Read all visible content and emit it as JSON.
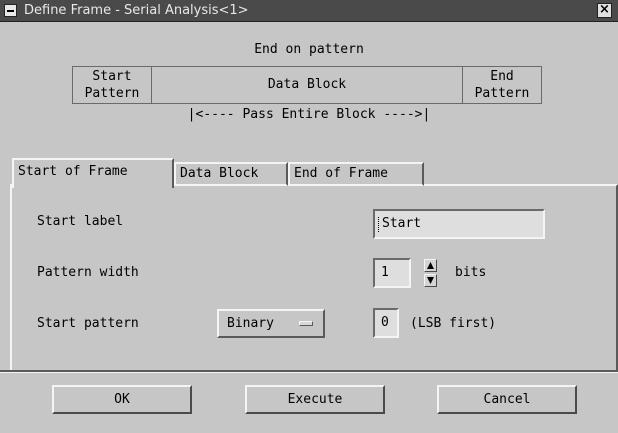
{
  "window": {
    "title": "Define Frame - Serial Analysis<1>",
    "close_glyph": "×"
  },
  "diagram": {
    "heading": "End on pattern",
    "start_cell": [
      "Start",
      "Pattern"
    ],
    "data_cell": "Data Block",
    "end_cell": [
      "End",
      "Pattern"
    ],
    "pass_line": "|<---- Pass Entire Block ---->|"
  },
  "tabs": [
    {
      "label": "Start of Frame",
      "active": true
    },
    {
      "label": "Data Block",
      "active": false
    },
    {
      "label": "End of Frame",
      "active": false
    }
  ],
  "start_of_frame": {
    "start_label_caption": "Start label",
    "start_label_value": "Start",
    "pattern_width_caption": "Pattern width",
    "pattern_width_value": "1",
    "pattern_width_unit": "bits",
    "start_pattern_caption": "Start pattern",
    "start_pattern_format": "Binary",
    "start_pattern_value": "0",
    "start_pattern_note": "(LSB first)"
  },
  "buttons": {
    "ok": "OK",
    "execute": "Execute",
    "cancel": "Cancel"
  },
  "icons": {
    "system_menu": "system-menu-icon",
    "spin_up": "arrow-up-icon",
    "spin_down": "arrow-down-icon",
    "option_indicator": "option-menu-indicator-icon"
  }
}
